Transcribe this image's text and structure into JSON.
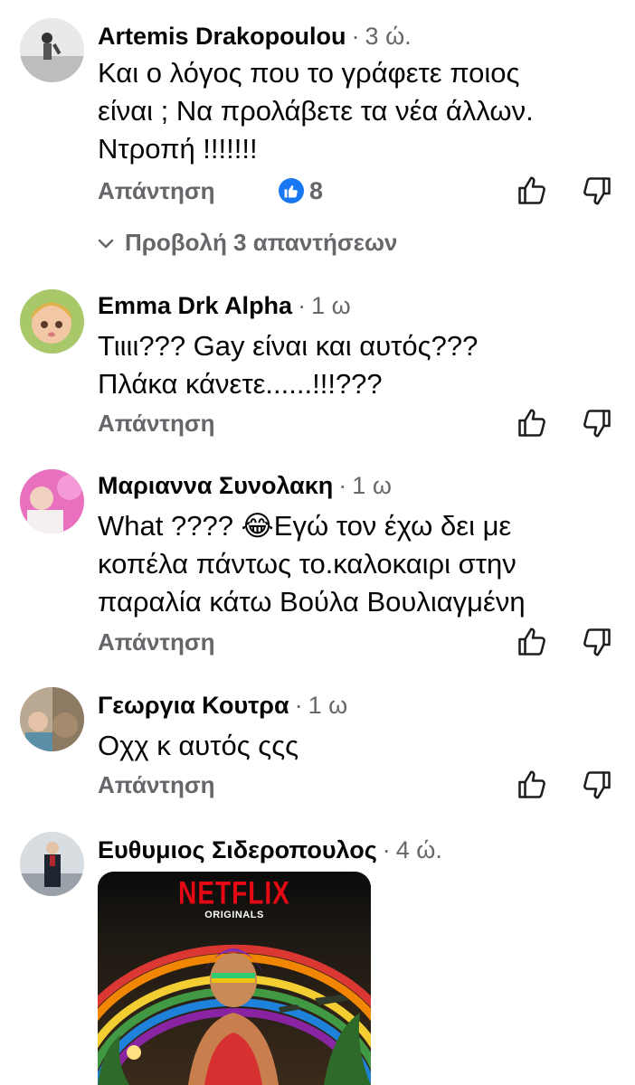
{
  "comments": [
    {
      "author": "Artemis Drakopoulou",
      "time": "3 ώ.",
      "lines": [
        "Και ο λόγος που το γράφετε ποιος",
        "είναι ; Να προλάβετε τα νέα άλλων.",
        "Ντροπή !!!!!!!"
      ],
      "reply_label": "Απάντηση",
      "reaction_count": "8",
      "view_replies": "Προβολή 3 απαντήσεων"
    },
    {
      "author": "Emma Drk Alpha",
      "time": "1 ω",
      "lines": [
        "Τιιιι??? Gay είναι και αυτός???",
        "Πλάκα κάνετε......!!!???"
      ],
      "reply_label": "Απάντηση"
    },
    {
      "author": "Μαριαννα Συνολακη",
      "time": "1 ω",
      "lines": [
        "What ???? 😂Εγώ τον έχω δει με",
        "κοπέλα πάντως το.καλοκαιρι στην",
        "παραλία κάτω Βούλα Βουλιαγμένη"
      ],
      "reply_label": "Απάντηση"
    },
    {
      "author": "Γεωργια Κουτρα",
      "time": "1 ω",
      "lines": [
        "Οχχ κ αυτός ςςς"
      ],
      "reply_label": "Απάντηση"
    },
    {
      "author": "Ευθυμιος Σιδεροπουλος",
      "time": "4 ώ.",
      "attachment": {
        "title": "NETFLIX",
        "subtitle": "ORIGINALS"
      }
    }
  ],
  "icons": {
    "like": "thumbs-up-icon",
    "dislike": "thumbs-down-icon",
    "reaction": "like-reaction-icon",
    "chevron": "chevron-down-icon"
  },
  "colors": {
    "text": "#050505",
    "secondary": "#65676b",
    "reaction_blue": "#1877f2",
    "netflix_red": "#e50914"
  }
}
